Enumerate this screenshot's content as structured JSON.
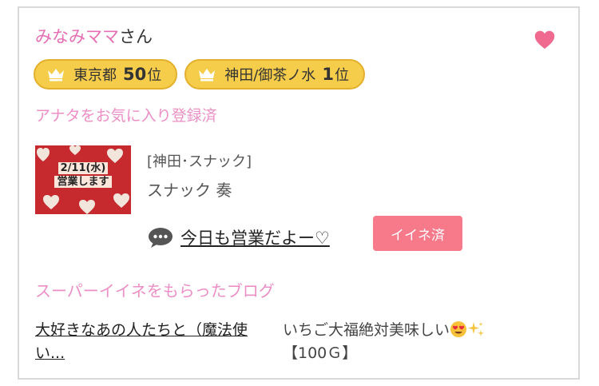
{
  "user": {
    "name": "みなみママ",
    "suffix": "さん"
  },
  "badges": [
    {
      "area": "東京都",
      "rank": "50",
      "unit": "位"
    },
    {
      "area": "神田/御茶ノ水",
      "rank": "1",
      "unit": "位"
    }
  ],
  "favorite_status": "アナタをお気に入り登録済",
  "shop": {
    "thumbnail_text_1": "2/11(水)",
    "thumbnail_text_2": "営業します",
    "category": "[神田･スナック]",
    "name": "スナック 奏"
  },
  "post": {
    "link_text": "今日も営業だよー♡",
    "iine_label": "イイネ済"
  },
  "super_iine": {
    "heading": "スーパーイイネをもらったブログ",
    "blogs": [
      {
        "title": "大好きなあの人たちと（魔法使い..."
      },
      {
        "title_prefix": "いちご大福絶対美味しい",
        "title_suffix": "【100Ｇ】"
      }
    ]
  },
  "colors": {
    "pink_text": "#ec8fc6",
    "badge_yellow": "#f6cd4a",
    "iine_button": "#f77a8b",
    "heart": "#f06a8f"
  },
  "icons": [
    "heart-icon",
    "crown-icon",
    "comment-icon",
    "emoji-heart-eyes",
    "sparkles-icon"
  ]
}
